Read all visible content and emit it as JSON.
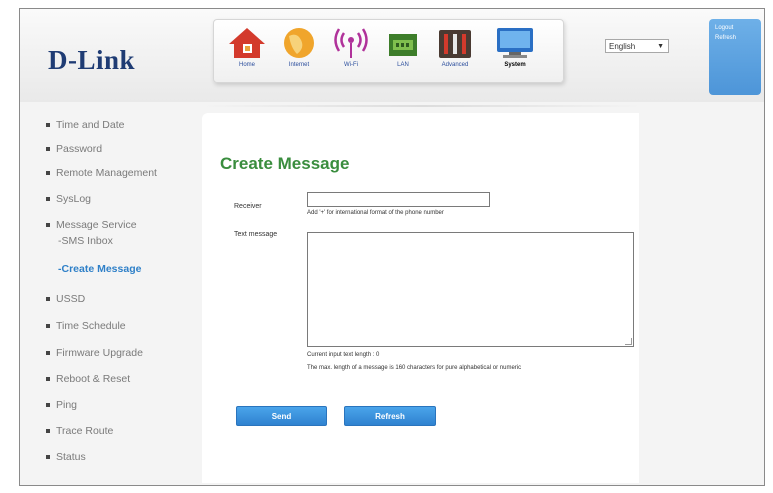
{
  "brand": {
    "logo_text": "D-Link"
  },
  "nav": {
    "items": [
      {
        "label": "Home",
        "icon": "home-icon",
        "active": false
      },
      {
        "label": "Internet",
        "icon": "globe-icon",
        "active": false
      },
      {
        "label": "Wi-Fi",
        "icon": "wifi-icon",
        "active": false
      },
      {
        "label": "LAN",
        "icon": "lan-icon",
        "active": false
      },
      {
        "label": "Advanced",
        "icon": "tools-icon",
        "active": false
      },
      {
        "label": "System",
        "icon": "computer-icon",
        "active": true
      }
    ]
  },
  "language": {
    "selected": "English"
  },
  "account": {
    "logout": "Logout",
    "refresh": "Refresh"
  },
  "sidebar": {
    "items": [
      {
        "label": "Time and Date"
      },
      {
        "label": "Password"
      },
      {
        "label": "Remote Management"
      },
      {
        "label": "SysLog"
      },
      {
        "label": "Message Service"
      },
      {
        "label": "-SMS Inbox"
      },
      {
        "label": "-Create Message"
      },
      {
        "label": "USSD"
      },
      {
        "label": "Time Schedule"
      },
      {
        "label": "Firmware Upgrade"
      },
      {
        "label": "Reboot & Reset"
      },
      {
        "label": "Ping"
      },
      {
        "label": "Trace Route"
      },
      {
        "label": "Status"
      }
    ]
  },
  "form": {
    "title": "Create Message",
    "receiver_label": "Receiver",
    "receiver_value": "",
    "receiver_hint": "Add '+' for international format of the phone number",
    "message_label": "Text message",
    "message_value": "",
    "length_text": "Current input text length : 0",
    "max_text": "The max. length of a message is 160 characters for pure alphabetical or numeric",
    "send_label": "Send",
    "refresh_label": "Refresh"
  },
  "colors": {
    "title_green": "#3a8d3e",
    "button_blue": "#3a8fdc",
    "logo_navy": "#1f3c74",
    "active_link": "#2f80c8"
  }
}
